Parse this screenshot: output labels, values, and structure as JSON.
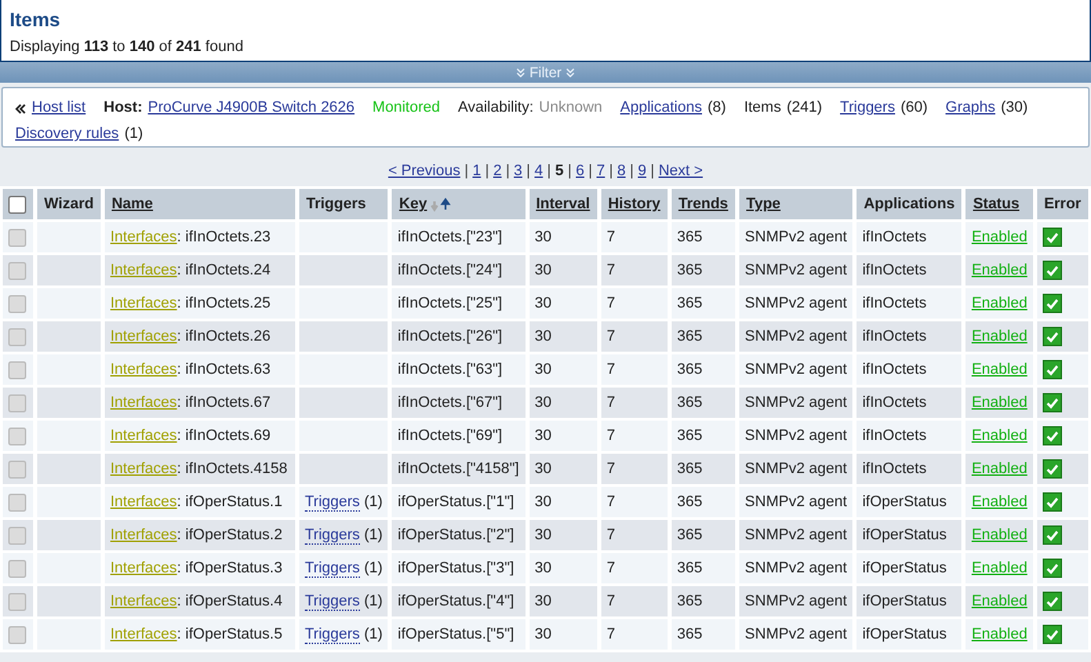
{
  "header": {
    "title": "Items",
    "summary": "Displaying **113** to **140** of **241** found"
  },
  "filter_bar": {
    "label": "Filter"
  },
  "host_nav": {
    "back": "Host list",
    "host_label": "Host:",
    "host": "ProCurve J4900B Switch 2626",
    "status": "Monitored",
    "availability_label": "Availability:",
    "availability": "Unknown",
    "links": [
      {
        "label": "Applications",
        "count": "(8)",
        "link": true
      },
      {
        "label": "Items",
        "count": "(241)",
        "link": false
      },
      {
        "label": "Triggers",
        "count": "(60)",
        "link": true
      },
      {
        "label": "Graphs",
        "count": "(30)",
        "link": true
      },
      {
        "label": "Discovery rules",
        "count": "(1)",
        "link": true
      }
    ]
  },
  "pager": {
    "separator": "|",
    "previous": "< Previous",
    "next": "Next >",
    "pages": [
      {
        "label": "1",
        "selected": false
      },
      {
        "label": "2",
        "selected": false
      },
      {
        "label": "3",
        "selected": false
      },
      {
        "label": "4",
        "selected": false
      },
      {
        "label": "5",
        "selected": true
      },
      {
        "label": "6",
        "selected": false
      },
      {
        "label": "7",
        "selected": false
      },
      {
        "label": "8",
        "selected": false
      },
      {
        "label": "9",
        "selected": false
      }
    ]
  },
  "table": {
    "select_all": {
      "checked": false
    },
    "name_separator": ":",
    "columns": [
      {
        "label": "Wizard",
        "sortable": false,
        "sorted": false
      },
      {
        "label": "Name",
        "sortable": true,
        "sorted": false
      },
      {
        "label": "Triggers",
        "sortable": false,
        "sorted": false
      },
      {
        "label": "Key",
        "sortable": true,
        "sorted": true
      },
      {
        "label": "Interval",
        "sortable": true,
        "sorted": false
      },
      {
        "label": "History",
        "sortable": true,
        "sorted": false
      },
      {
        "label": "Trends",
        "sortable": true,
        "sorted": false
      },
      {
        "label": "Type",
        "sortable": true,
        "sorted": false
      },
      {
        "label": "Applications",
        "sortable": false,
        "sorted": false
      },
      {
        "label": "Status",
        "sortable": true,
        "sorted": false
      },
      {
        "label": "Error",
        "sortable": false,
        "sorted": false
      }
    ],
    "rows": [
      {
        "checked": false,
        "template": "Interfaces",
        "name": "ifInOctets.23",
        "key": "ifInOctets.[\"23\"]",
        "interval": "30",
        "history": "7",
        "trends": "365",
        "type": "SNMPv2 agent",
        "applications": "ifInOctets",
        "status": "Enabled",
        "error": false
      },
      {
        "checked": false,
        "template": "Interfaces",
        "name": "ifInOctets.24",
        "key": "ifInOctets.[\"24\"]",
        "interval": "30",
        "history": "7",
        "trends": "365",
        "type": "SNMPv2 agent",
        "applications": "ifInOctets",
        "status": "Enabled",
        "error": false
      },
      {
        "checked": false,
        "template": "Interfaces",
        "name": "ifInOctets.25",
        "key": "ifInOctets.[\"25\"]",
        "interval": "30",
        "history": "7",
        "trends": "365",
        "type": "SNMPv2 agent",
        "applications": "ifInOctets",
        "status": "Enabled",
        "error": false
      },
      {
        "checked": false,
        "template": "Interfaces",
        "name": "ifInOctets.26",
        "key": "ifInOctets.[\"26\"]",
        "interval": "30",
        "history": "7",
        "trends": "365",
        "type": "SNMPv2 agent",
        "applications": "ifInOctets",
        "status": "Enabled",
        "error": false
      },
      {
        "checked": false,
        "template": "Interfaces",
        "name": "ifInOctets.63",
        "key": "ifInOctets.[\"63\"]",
        "interval": "30",
        "history": "7",
        "trends": "365",
        "type": "SNMPv2 agent",
        "applications": "ifInOctets",
        "status": "Enabled",
        "error": false
      },
      {
        "checked": false,
        "template": "Interfaces",
        "name": "ifInOctets.67",
        "key": "ifInOctets.[\"67\"]",
        "interval": "30",
        "history": "7",
        "trends": "365",
        "type": "SNMPv2 agent",
        "applications": "ifInOctets",
        "status": "Enabled",
        "error": false
      },
      {
        "checked": false,
        "template": "Interfaces",
        "name": "ifInOctets.69",
        "key": "ifInOctets.[\"69\"]",
        "interval": "30",
        "history": "7",
        "trends": "365",
        "type": "SNMPv2 agent",
        "applications": "ifInOctets",
        "status": "Enabled",
        "error": false
      },
      {
        "checked": false,
        "template": "Interfaces",
        "name": "ifInOctets.4158",
        "key": "ifInOctets.[\"4158\"]",
        "interval": "30",
        "history": "7",
        "trends": "365",
        "type": "SNMPv2 agent",
        "applications": "ifInOctets",
        "status": "Enabled",
        "error": false
      },
      {
        "checked": false,
        "template": "Interfaces",
        "name": "ifOperStatus.1",
        "triggers": {
          "label": "Triggers",
          "count": "(1)"
        },
        "key": "ifOperStatus.[\"1\"]",
        "interval": "30",
        "history": "7",
        "trends": "365",
        "type": "SNMPv2 agent",
        "applications": "ifOperStatus",
        "status": "Enabled",
        "error": false
      },
      {
        "checked": false,
        "template": "Interfaces",
        "name": "ifOperStatus.2",
        "triggers": {
          "label": "Triggers",
          "count": "(1)"
        },
        "key": "ifOperStatus.[\"2\"]",
        "interval": "30",
        "history": "7",
        "trends": "365",
        "type": "SNMPv2 agent",
        "applications": "ifOperStatus",
        "status": "Enabled",
        "error": false
      },
      {
        "checked": false,
        "template": "Interfaces",
        "name": "ifOperStatus.3",
        "triggers": {
          "label": "Triggers",
          "count": "(1)"
        },
        "key": "ifOperStatus.[\"3\"]",
        "interval": "30",
        "history": "7",
        "trends": "365",
        "type": "SNMPv2 agent",
        "applications": "ifOperStatus",
        "status": "Enabled",
        "error": false
      },
      {
        "checked": false,
        "template": "Interfaces",
        "name": "ifOperStatus.4",
        "triggers": {
          "label": "Triggers",
          "count": "(1)"
        },
        "key": "ifOperStatus.[\"4\"]",
        "interval": "30",
        "history": "7",
        "trends": "365",
        "type": "SNMPv2 agent",
        "applications": "ifOperStatus",
        "status": "Enabled",
        "error": false
      },
      {
        "checked": false,
        "template": "Interfaces",
        "name": "ifOperStatus.5",
        "triggers": {
          "label": "Triggers",
          "count": "(1)"
        },
        "key": "ifOperStatus.[\"5\"]",
        "interval": "30",
        "history": "7",
        "trends": "365",
        "type": "SNMPv2 agent",
        "applications": "ifOperStatus",
        "status": "Enabled",
        "error": false
      }
    ]
  }
}
